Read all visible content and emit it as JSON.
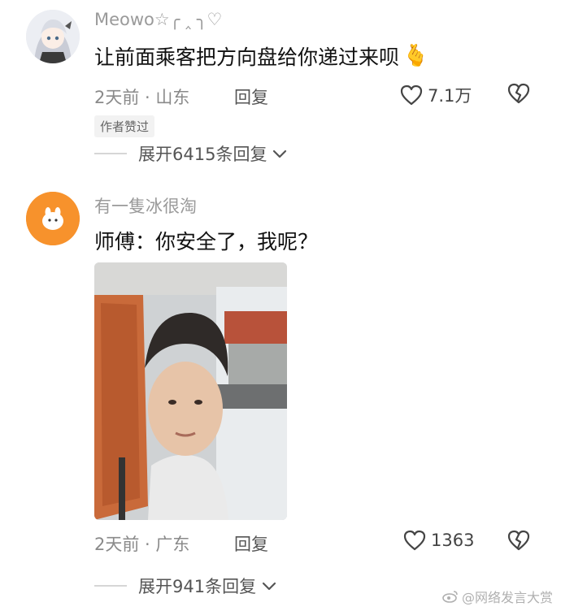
{
  "comments": [
    {
      "username": "Meowo☆╭ ‸ ╮♡",
      "text": "让前面乘客把方向盘给你递过来呗",
      "emoji": "🫰",
      "time_location": "2天前 · 山东",
      "reply_label": "回复",
      "likes": "7.1万",
      "badge": "作者赞过",
      "expand_label": "展开6415条回复"
    },
    {
      "username": "有一隻冰很淘",
      "text": "师傅：你安全了，我呢？",
      "time_location": "2天前 · 广东",
      "reply_label": "回复",
      "likes": "1363",
      "expand_label": "展开941条回复"
    }
  ],
  "watermark": "@网络发言大赏",
  "colors": {
    "meta": "#8a8a8a",
    "username": "#9a9a9a",
    "avatar2": "#f7922c",
    "seat": "#c96a3a"
  }
}
